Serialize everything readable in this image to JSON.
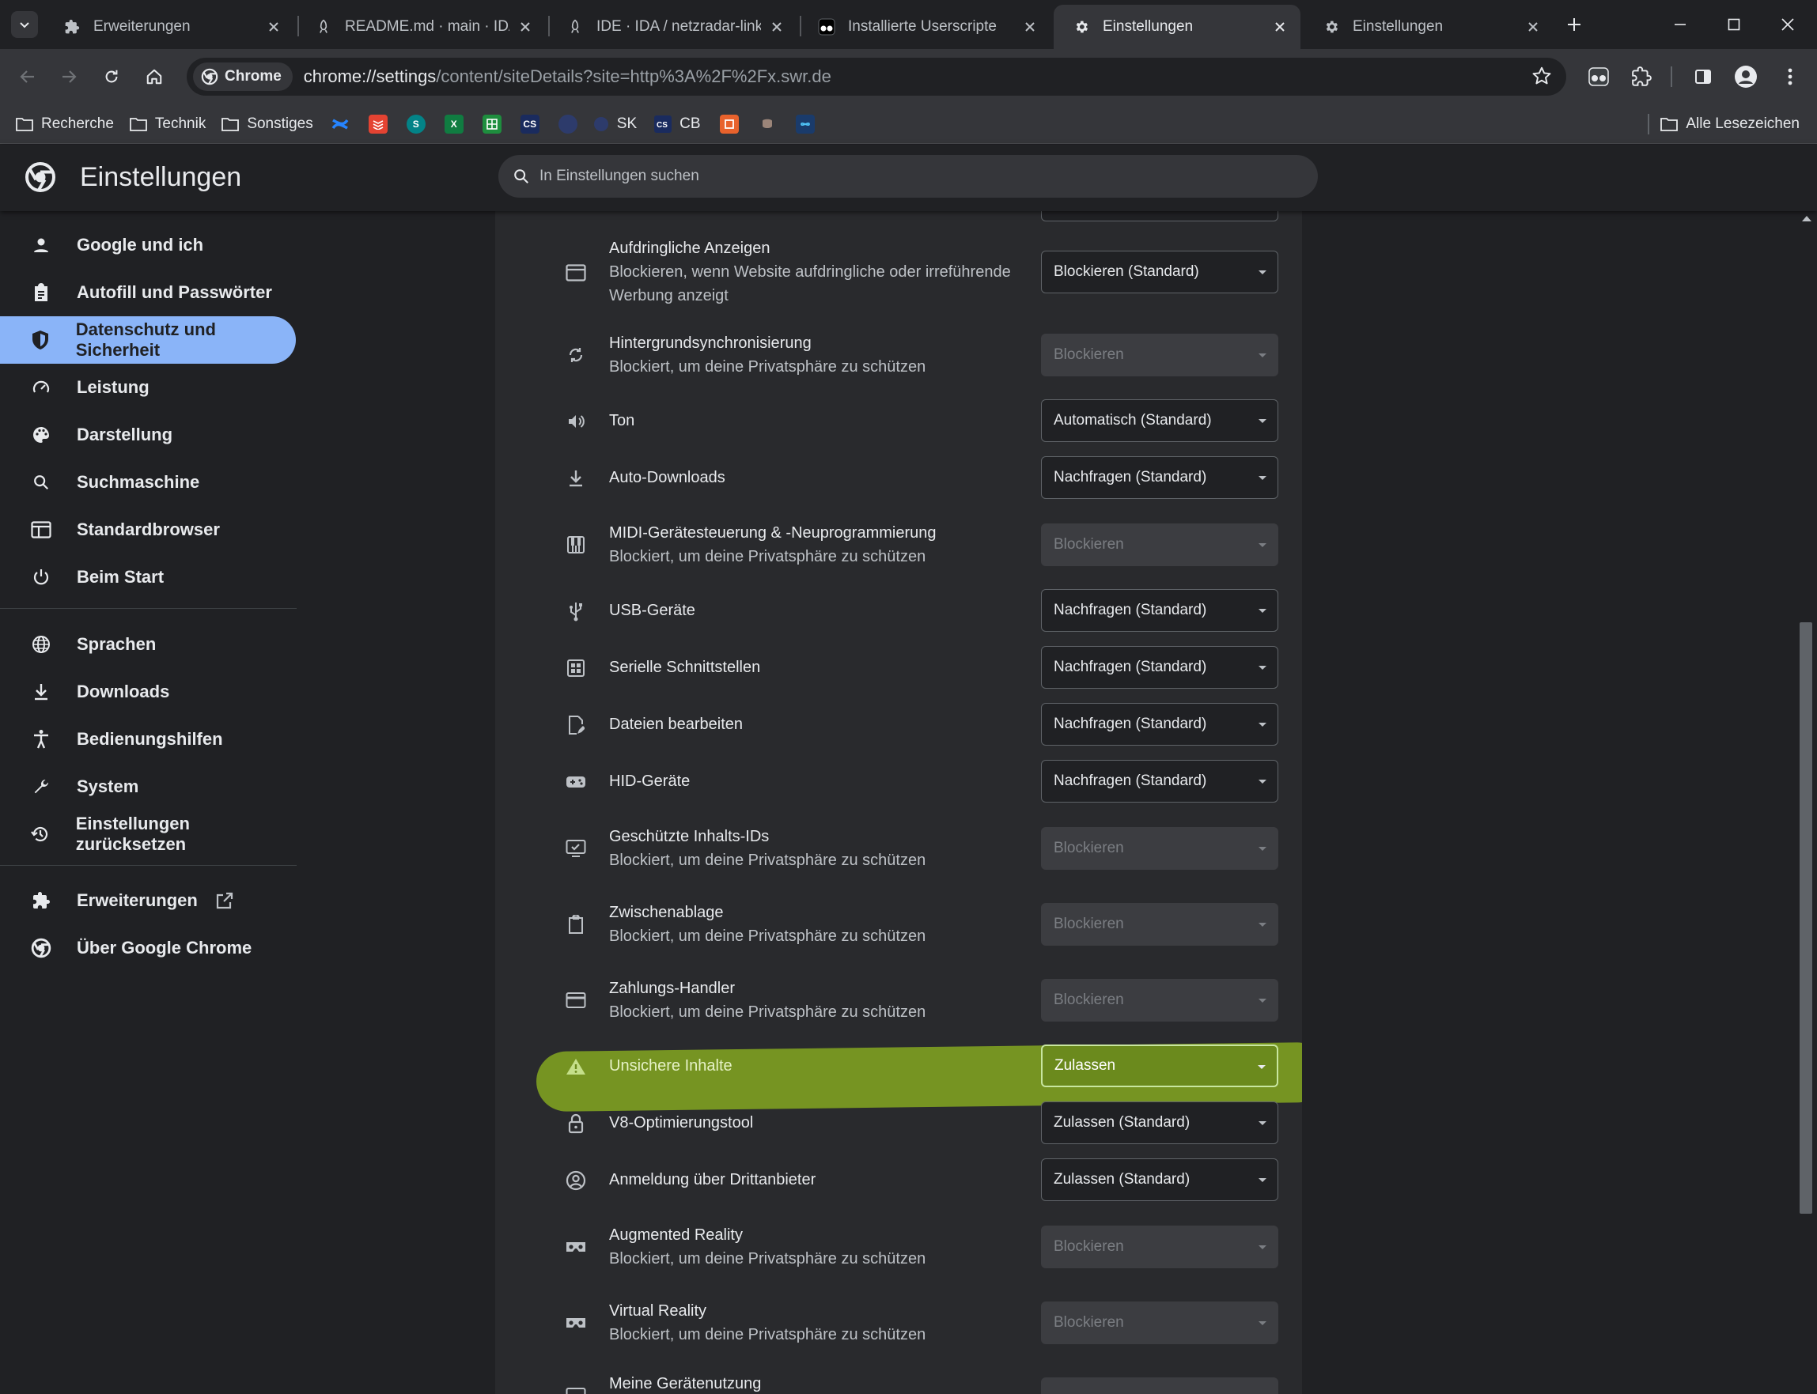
{
  "tabs": [
    {
      "title": "Erweiterungen",
      "icon": "puzzle-icon"
    },
    {
      "title": "README.md · main · IDA / ",
      "icon": "rocket-icon"
    },
    {
      "title": "IDE · IDA / netzradar-linker",
      "icon": "rocket-icon"
    },
    {
      "title": "Installierte Userscripte",
      "icon": "tampermonkey-icon"
    },
    {
      "title": "Einstellungen",
      "icon": "gear-icon",
      "active": true
    },
    {
      "title": "Einstellungen",
      "icon": "gear-icon"
    }
  ],
  "omnibox": {
    "chip": "Chrome",
    "url_host": "chrome://settings",
    "url_path": "/content/siteDetails?site=http%3A%2F%2Fx.swr.de"
  },
  "bookmarks": {
    "folders": [
      "Recherche",
      "Technik",
      "Sonstiges"
    ],
    "sk": "SK",
    "cs_badge": "CS",
    "cb": "CB",
    "all": "Alle Lesezeichen"
  },
  "settings": {
    "title": "Einstellungen",
    "search_placeholder": "In Einstellungen suchen"
  },
  "sidebar": {
    "items": [
      {
        "label": "Google und ich",
        "icon": "person-icon"
      },
      {
        "label": "Autofill und Passwörter",
        "icon": "clipboard-icon"
      },
      {
        "label": "Datenschutz und Sicherheit",
        "icon": "shield-icon",
        "active": true
      },
      {
        "label": "Leistung",
        "icon": "speedometer-icon"
      },
      {
        "label": "Darstellung",
        "icon": "palette-icon"
      },
      {
        "label": "Suchmaschine",
        "icon": "search-icon"
      },
      {
        "label": "Standardbrowser",
        "icon": "browser-icon"
      },
      {
        "label": "Beim Start",
        "icon": "power-icon"
      },
      {
        "label": "Sprachen",
        "icon": "globe-icon"
      },
      {
        "label": "Downloads",
        "icon": "download-icon"
      },
      {
        "label": "Bedienungshilfen",
        "icon": "accessibility-icon"
      },
      {
        "label": "System",
        "icon": "wrench-icon"
      },
      {
        "label": "Einstellungen zurücksetzen",
        "icon": "history-icon"
      },
      {
        "label": "Erweiterungen",
        "icon": "puzzle-icon"
      },
      {
        "label": "Über Google Chrome",
        "icon": "chrome-icon"
      }
    ]
  },
  "permissions": [
    {
      "title": "Aufdringliche Anzeigen",
      "subtitle": "Blockieren, wenn Website aufdringliche oder irreführende Werbung anzeigt",
      "value": "Blockieren (Standard)",
      "icon": "ads-icon",
      "disabled": false
    },
    {
      "title": "Hintergrundsynchronisierung",
      "subtitle": "Blockiert, um deine Privatsphäre zu schützen",
      "value": "Blockieren",
      "icon": "sync-icon",
      "disabled": true
    },
    {
      "title": "Ton",
      "subtitle": "",
      "value": "Automatisch (Standard)",
      "icon": "speaker-icon",
      "disabled": false
    },
    {
      "title": "Auto-Downloads",
      "subtitle": "",
      "value": "Nachfragen (Standard)",
      "icon": "download-icon",
      "disabled": false
    },
    {
      "title": "MIDI-Gerätesteuerung & -Neuprogrammierung",
      "subtitle": "Blockiert, um deine Privatsphäre zu schützen",
      "value": "Blockieren",
      "icon": "piano-icon",
      "disabled": true
    },
    {
      "title": "USB-Geräte",
      "subtitle": "",
      "value": "Nachfragen (Standard)",
      "icon": "usb-icon",
      "disabled": false
    },
    {
      "title": "Serielle Schnittstellen",
      "subtitle": "",
      "value": "Nachfragen (Standard)",
      "icon": "serial-port-icon",
      "disabled": false
    },
    {
      "title": "Dateien bearbeiten",
      "subtitle": "",
      "value": "Nachfragen (Standard)",
      "icon": "file-edit-icon",
      "disabled": false
    },
    {
      "title": "HID-Geräte",
      "subtitle": "",
      "value": "Nachfragen (Standard)",
      "icon": "gamepad-icon",
      "disabled": false
    },
    {
      "title": "Geschützte Inhalts-IDs",
      "subtitle": "Blockiert, um deine Privatsphäre zu schützen",
      "value": "Blockieren",
      "icon": "protected-content-icon",
      "disabled": true
    },
    {
      "title": "Zwischenablage",
      "subtitle": "Blockiert, um deine Privatsphäre zu schützen",
      "value": "Blockieren",
      "icon": "clipboard-icon",
      "disabled": true
    },
    {
      "title": "Zahlungs-Handler",
      "subtitle": "Blockiert, um deine Privatsphäre zu schützen",
      "value": "Blockieren",
      "icon": "credit-card-icon",
      "disabled": true
    },
    {
      "title": "Unsichere Inhalte",
      "subtitle": "",
      "value": "Zulassen",
      "icon": "warning-icon",
      "disabled": false,
      "highlighted": true
    },
    {
      "title": "V8-Optimierungstool",
      "subtitle": "",
      "value": "Zulassen (Standard)",
      "icon": "lock-icon",
      "disabled": false
    },
    {
      "title": "Anmeldung über Drittanbieter",
      "subtitle": "",
      "value": "Zulassen (Standard)",
      "icon": "account-circle-icon",
      "disabled": false
    },
    {
      "title": "Augmented Reality",
      "subtitle": "Blockiert, um deine Privatsphäre zu schützen",
      "value": "Blockieren",
      "icon": "vr-headset-icon",
      "disabled": true
    },
    {
      "title": "Virtual Reality",
      "subtitle": "Blockiert, um deine Privatsphäre zu schützen",
      "value": "Blockieren",
      "icon": "vr-headset-icon",
      "disabled": true
    },
    {
      "title": "Meine Gerätenutzung",
      "subtitle": "",
      "value": "",
      "icon": "device-usage-icon",
      "disabled": true
    }
  ],
  "colors": {
    "accent": "#8ab4f8",
    "highlight_marker": "#7a9a22",
    "background": "#202124",
    "card": "#292a2d"
  }
}
